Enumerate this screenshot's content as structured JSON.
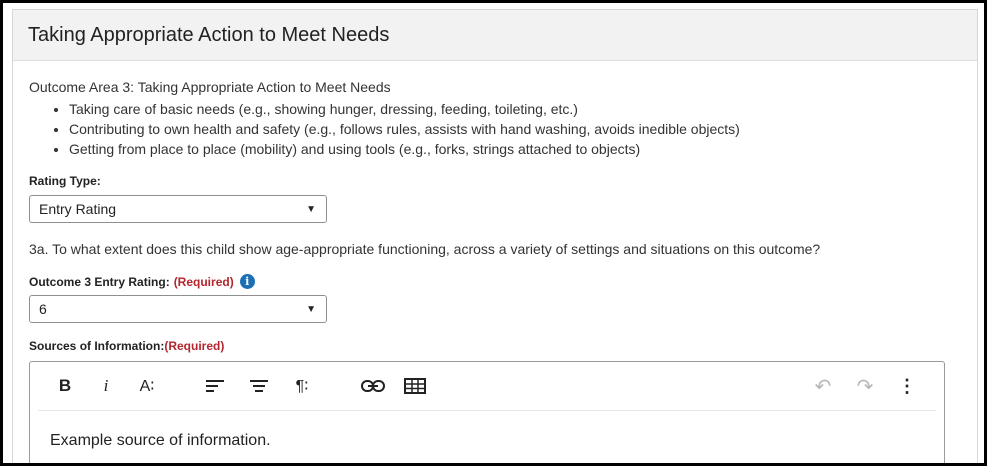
{
  "panel": {
    "title": "Taking Appropriate Action to Meet Needs"
  },
  "outcome": {
    "heading": "Outcome Area 3: Taking Appropriate Action to Meet Needs",
    "bullets": [
      "Taking care of basic needs (e.g., showing hunger, dressing, feeding, toileting, etc.)",
      "Contributing to own health and safety (e.g., follows rules, assists with hand washing, avoids inedible objects)",
      "Getting from place to place (mobility) and using tools (e.g., forks, strings attached to objects)"
    ]
  },
  "rating_type": {
    "label": "Rating Type:",
    "value": "Entry Rating"
  },
  "question": {
    "text": "3a. To what extent does this child show age-appropriate functioning, across a variety of settings and situations on this outcome?"
  },
  "entry_rating": {
    "label": "Outcome 3 Entry Rating:",
    "required": "(Required)",
    "info_glyph": "i",
    "value": "6"
  },
  "sources": {
    "label": "Sources of Information:",
    "required": "(Required)",
    "content": "Example source of information."
  },
  "toolbar": {
    "bold": "B",
    "italic": "i",
    "font_size": "A∶",
    "align": "≡",
    "paragraph": "¶∶",
    "undo": "↶",
    "redo": "↷",
    "more": "⋮"
  },
  "icons": [
    "info-icon",
    "chevron-down-icon",
    "bold-icon",
    "italic-icon",
    "font-size-icon",
    "align-left-icon",
    "align-center-icon",
    "paragraph-icon",
    "link-icon",
    "table-icon",
    "undo-icon",
    "redo-icon",
    "more-vertical-icon"
  ],
  "colors": {
    "required": "#b3262d",
    "info": "#1c6fb5",
    "header_bg": "#f2f2f2"
  }
}
